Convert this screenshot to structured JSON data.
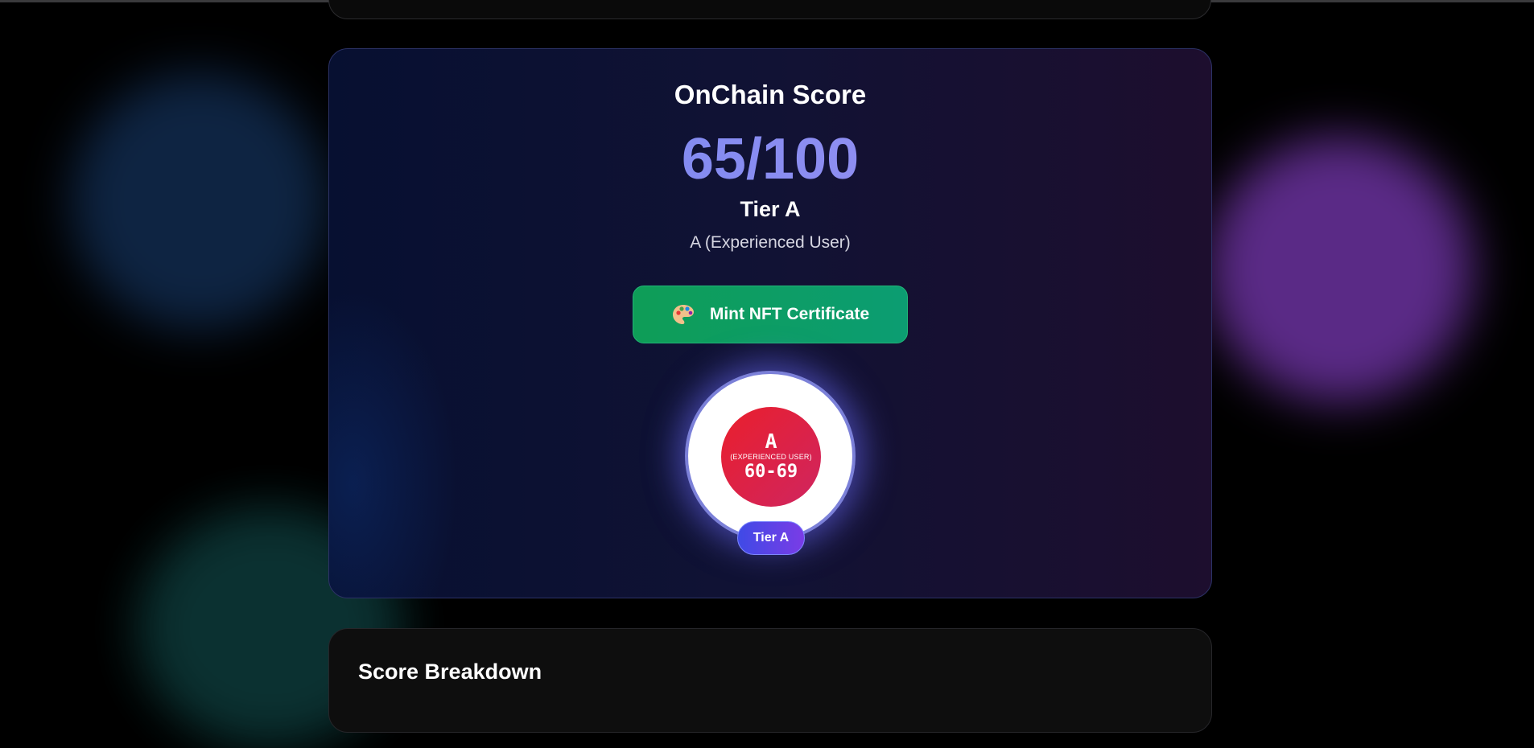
{
  "score_card": {
    "title": "OnChain Score",
    "score": "65/100",
    "tier": "Tier A",
    "tier_description": "A (Experienced User)"
  },
  "mint_button": {
    "icon": "palette-icon",
    "label": "Mint NFT Certificate"
  },
  "badge": {
    "letter": "A",
    "subtitle": "(EXPERIENCED USER)",
    "range": "60-69",
    "pill": "Tier A"
  },
  "breakdown": {
    "title": "Score Breakdown"
  },
  "colors": {
    "background": "#000000",
    "score_gradient_start": "#6f86ef",
    "score_gradient_end": "#a393f3",
    "mint_button": "#0e9d57",
    "badge_red": "#ea1f2c",
    "tier_pill": "#5a44e6"
  }
}
